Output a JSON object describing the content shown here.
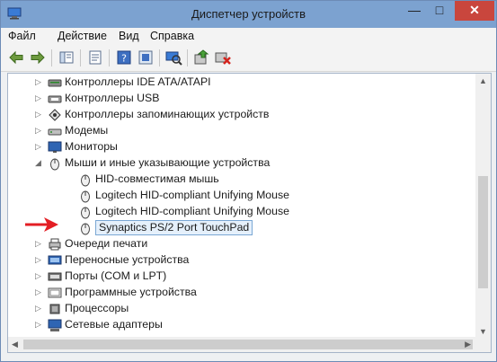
{
  "window": {
    "title": "Диспетчер устройств",
    "min_label": "—",
    "max_label": "□",
    "close_label": "✕"
  },
  "menu": [
    {
      "label": "Файл"
    },
    {
      "label": "Действие"
    },
    {
      "label": "Вид"
    },
    {
      "label": "Справка"
    }
  ],
  "toolbar": {
    "buttons": [
      {
        "name": "back-icon"
      },
      {
        "name": "forward-icon"
      },
      {
        "name": "show-hide-tree-icon"
      },
      {
        "name": "properties-icon"
      },
      {
        "name": "help-icon"
      },
      {
        "name": "action-view-icon"
      },
      {
        "name": "scan-hardware-icon"
      },
      {
        "name": "update-driver-icon"
      },
      {
        "name": "uninstall-icon"
      }
    ]
  },
  "tree": [
    {
      "label": "Контроллеры IDE ATA/ATAPI",
      "expander": "▷",
      "icon": "ide-controller-icon",
      "level": 0
    },
    {
      "label": "Контроллеры USB",
      "expander": "▷",
      "icon": "usb-controller-icon",
      "level": 0
    },
    {
      "label": "Контроллеры запоминающих устройств",
      "expander": "▷",
      "icon": "storage-controller-icon",
      "level": 0
    },
    {
      "label": "Модемы",
      "expander": "▷",
      "icon": "modem-icon",
      "level": 0
    },
    {
      "label": "Мониторы",
      "expander": "▷",
      "icon": "monitor-icon",
      "level": 0
    },
    {
      "label": "Мыши и иные указывающие устройства",
      "expander": "◢",
      "icon": "mouse-icon",
      "level": 0
    },
    {
      "label": "HID-совместимая мышь",
      "expander": "",
      "icon": "mouse-icon",
      "level": 1
    },
    {
      "label": "Logitech HID-compliant Unifying Mouse",
      "expander": "",
      "icon": "mouse-icon",
      "level": 1
    },
    {
      "label": "Logitech HID-compliant Unifying Mouse",
      "expander": "",
      "icon": "mouse-icon",
      "level": 1
    },
    {
      "label": "Synaptics PS/2 Port TouchPad",
      "expander": "",
      "icon": "mouse-icon",
      "level": 1,
      "selected": true
    },
    {
      "label": "Очереди печати",
      "expander": "▷",
      "icon": "printer-queue-icon",
      "level": 0
    },
    {
      "label": "Переносные устройства",
      "expander": "▷",
      "icon": "portable-device-icon",
      "level": 0
    },
    {
      "label": "Порты (COM и LPT)",
      "expander": "▷",
      "icon": "port-icon",
      "level": 0
    },
    {
      "label": "Программные устройства",
      "expander": "▷",
      "icon": "software-device-icon",
      "level": 0
    },
    {
      "label": "Процессоры",
      "expander": "▷",
      "icon": "processor-icon",
      "level": 0
    },
    {
      "label": "Сетевые адаптеры",
      "expander": "▷",
      "icon": "network-adapter-icon",
      "level": 0
    }
  ],
  "colors": {
    "annotation_arrow": "#e31e24",
    "selection_border": "#7aa7d4",
    "selection_fill": "#e5f0fb"
  }
}
